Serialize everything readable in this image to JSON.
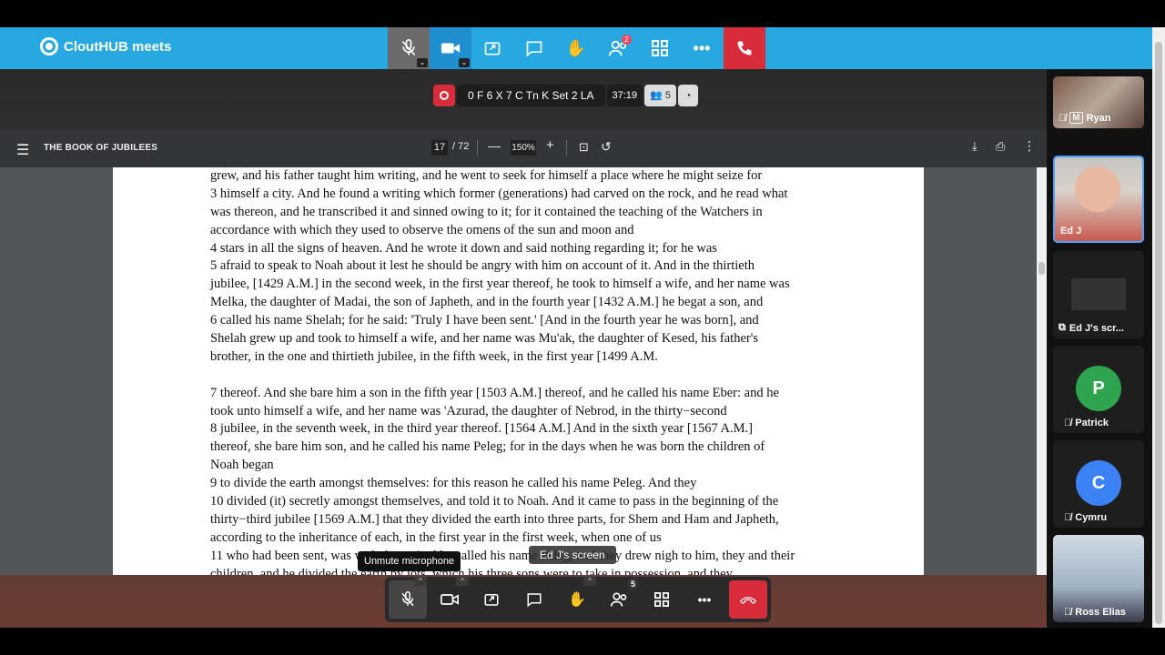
{
  "app": {
    "brand": "CloutHUB meets"
  },
  "topbar": {
    "participants_badge": "2"
  },
  "recording": {
    "room_name": "0 F 6 X 7 C Tn K Set 2 LA",
    "timer": "37:19",
    "participant_count": "5"
  },
  "pdf": {
    "title": "THE BOOK OF JUBILEES",
    "page_current": "17",
    "page_total": "/ 72",
    "zoom": "150%",
    "lines": [
      "grew, and his father taught him  writing, and he went to seek for  himself a place where he might seize  for",
      "3 himself a city. And he found a writing which former  (generations) had carved on the  rock, and he read what",
      "was thereon,  and he transcribed it and sinned owing to it; for it  contained the  teaching of the Watchers in",
      "accordance with which they used to observe  the  omens of the sun and moon and",
      "4 stars in all the signs of heaven. And he wrote it down and said  nothing regarding it;  for he was",
      "5 afraid to speak to Noah about it lest he should be angry with  him on account of it. And  in the thirtieth",
      "jubilee, [1429 A.M.] in the  second week, in the first year thereof, he  took to himself a wife,  and  her name was",
      "Melka, the daughter of Madai, the son of Japheth,  and in  the fourth year [1432 A.M.] he begat a son, and",
      "6 called his name Shelah; for he said: 'Truly I have been sent.'  [And in the fourth year  he was born], and",
      "Shelah grew up and took to  himself a wife, and her name was Mu'ak, the  daughter of Kesed, his  father's",
      "brother, in the one and thirtieth jubilee, in the fifth  week,  in the first year [1499 A.M.",
      "",
      "7 thereof. And she bare him a son in the fifth year [1503 A.M.]  thereof, and he called  his name Eber: and he",
      "took unto himself a wife,  and her name was 'Azurad, the daughter of  Nebrod, in the thirty−second",
      "8 jubilee, in the seventh week, in the third year thereof. [1564  A.M.] And in the sixth  year [1567 A.M.]",
      "thereof, she bare him son, and  he called his name Peleg; for in the days  when he was born the  children of",
      "Noah began",
      "9 to divide the earth amongst themselves: for this reason he  called his name Peleg. And  they",
      "10 divided (it) secretly amongst themselves, and told it to Noah.  And it came to pass in  the beginning of the",
      "thirty−third jubilee [1569  A.M.] that they divided the earth into  three parts, for Shem and Ham  and Japheth,",
      "according to the inheritance of each, in the  first year  in the first week, when one of us",
      "11 who had been sent, was with them.  And he called his name Peleg, and they drew nigh to him,  they and their",
      "children, and he divided the earth by lots, which his three sons were  to take in possession, and they"
    ]
  },
  "overlay": {
    "tooltip": "Unmute microphone",
    "screen_label": "Ed J's screen"
  },
  "bottombar": {
    "participants_badge": "5"
  },
  "participants": [
    {
      "name": "Ryan",
      "tag": "M"
    },
    {
      "name": "Ed J"
    },
    {
      "name": "Ed J's scr..."
    },
    {
      "name": "Patrick",
      "initial": "P",
      "color": "#2ea44f"
    },
    {
      "name": "Cymru",
      "initial": "C",
      "color": "#3b82f6"
    },
    {
      "name": "Ross Elias"
    }
  ]
}
